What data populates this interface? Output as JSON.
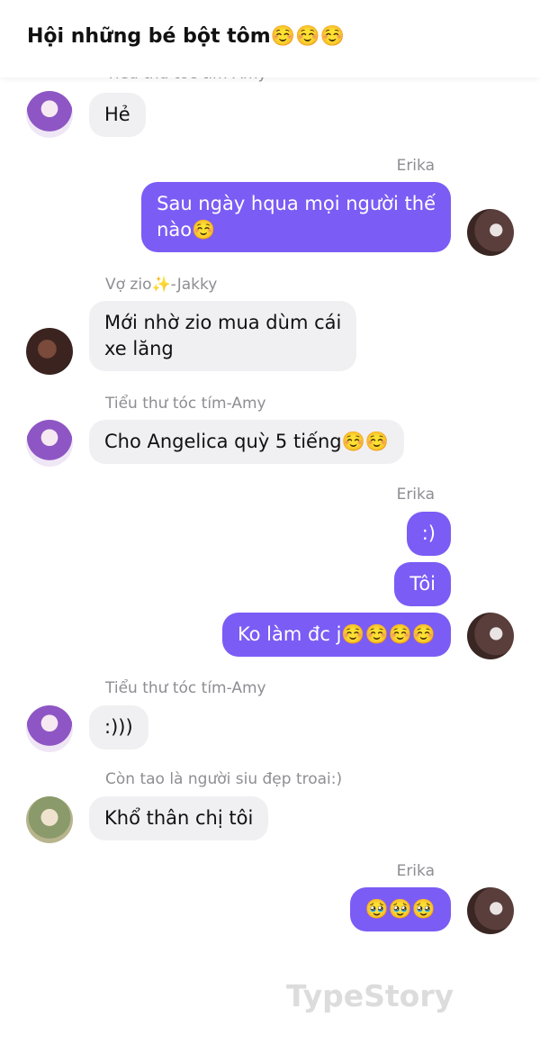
{
  "header": {
    "title": "Hội những bé bột tôm☺️☺️☺️"
  },
  "messages": {
    "m0": {
      "sender": "Tiểu thư tóc tím-Amy",
      "text": "Hẻ"
    },
    "m1": {
      "sender": "Erika",
      "text_line1": "Sau ngày hqua mọi người thế",
      "text_line2": "nào☺️"
    },
    "m2": {
      "sender": "Vợ zio✨-Jakky",
      "text_line1": "Mới nhờ zio mua dùm cái",
      "text_line2": "xe lăng"
    },
    "m3": {
      "sender": "Tiểu thư tóc tím-Amy",
      "text": "Cho Angelica quỳ 5 tiếng☺️☺️"
    },
    "m4": {
      "sender": "Erika",
      "texts": [
        ":)",
        "Tôi",
        "Ko làm đc j☺️☺️☺️☺️"
      ]
    },
    "m5": {
      "sender": "Tiểu thư tóc tím-Amy",
      "text": ":)))"
    },
    "m6": {
      "sender": "Còn tao là người siu đẹp troai:)",
      "text": "Khổ thân chị tôi"
    },
    "m7": {
      "sender": "Erika",
      "text": "🥹🥹🥹"
    }
  },
  "watermark": "TypeStory",
  "colors": {
    "outgoing_bubble": "#7b5cf5",
    "incoming_bubble": "#f0f0f2",
    "sender_name": "#8e8e93"
  },
  "icons": {
    "amy_avatar": "avatar-amy-icon",
    "erika_avatar": "avatar-erika-icon",
    "jakky_avatar": "avatar-jakky-icon",
    "siu_avatar": "avatar-siu-icon"
  }
}
